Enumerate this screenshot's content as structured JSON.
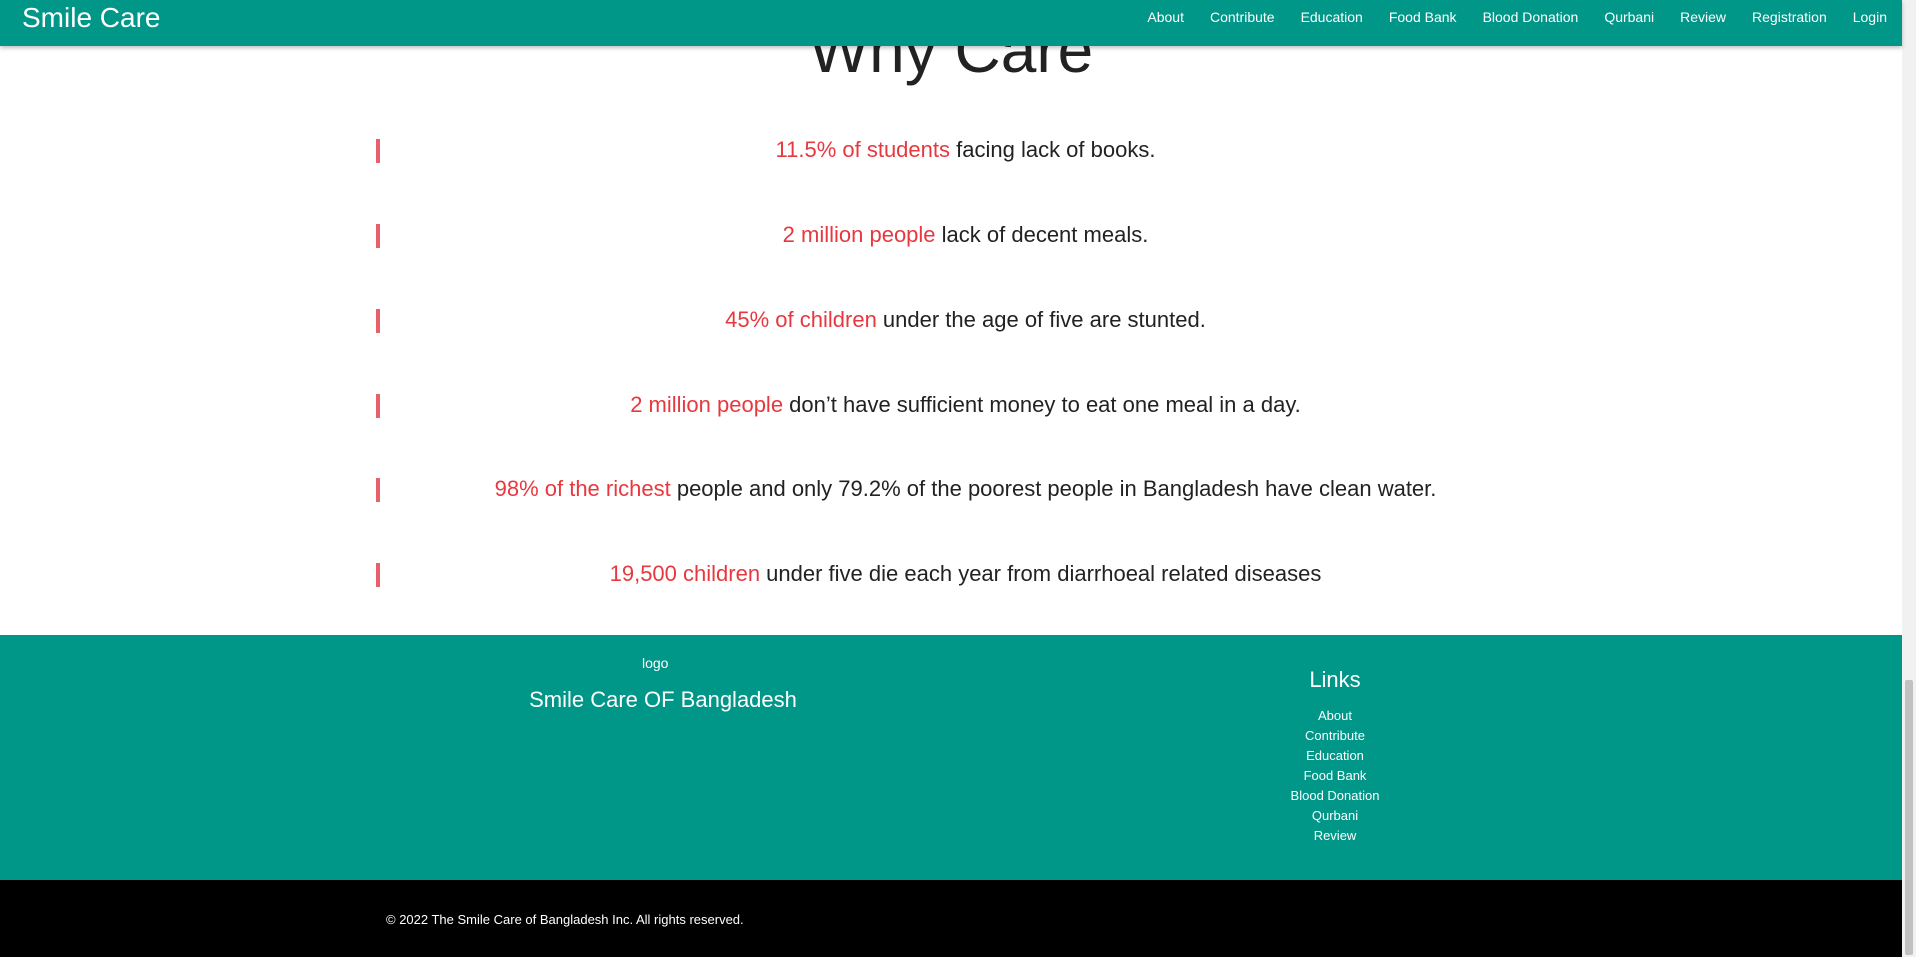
{
  "navbar": {
    "brand": "Smile Care",
    "links": [
      "About",
      "Contribute",
      "Education",
      "Food Bank",
      "Blood Donation",
      "Qurbani",
      "Review",
      "Registration",
      "Login"
    ]
  },
  "main": {
    "title": "Why Care",
    "facts": [
      {
        "highlight": "11.5% of students",
        "text": " facing lack of books."
      },
      {
        "highlight": "2 million people",
        "text": " lack of decent meals."
      },
      {
        "highlight": "45% of children",
        "text": " under the age of five are stunted."
      },
      {
        "highlight": "2 million people",
        "text": " don’t have sufficient money to eat one meal in a day."
      },
      {
        "highlight": "98% of the richest",
        "text": " people and only 79.2% of the poorest people in Bangladesh have clean water."
      },
      {
        "highlight": "19,500 children",
        "text": " under five die each year from diarrhoeal related diseases"
      }
    ]
  },
  "footer": {
    "logo_alt": "logo",
    "org_name": "Smile Care OF Bangladesh",
    "links_title": "Links",
    "links": [
      "About",
      "Contribute",
      "Education",
      "Food Bank",
      "Blood Donation",
      "Qurbani",
      "Review"
    ],
    "copyright": "© 2022 The Smile Care of Bangladesh Inc. All rights reserved."
  },
  "colors": {
    "teal": "#009688",
    "highlight": "#e8383f",
    "bar": "#e8606a"
  }
}
